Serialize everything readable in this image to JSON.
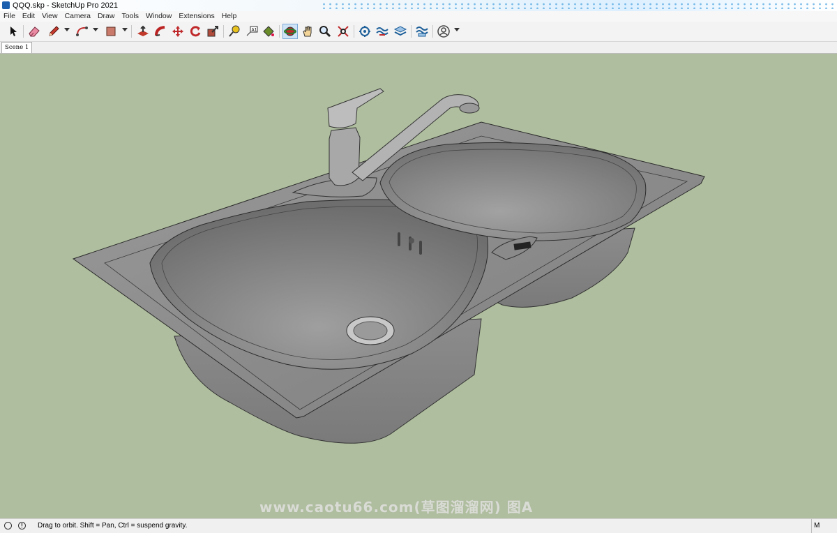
{
  "window": {
    "title": "QQQ.skp - SketchUp Pro 2021"
  },
  "menu": [
    "File",
    "Edit",
    "View",
    "Camera",
    "Draw",
    "Tools",
    "Window",
    "Extensions",
    "Help"
  ],
  "toolbar": {
    "icons": [
      "select-icon",
      "eraser-icon",
      "pencil-icon",
      "arc-icon",
      "rectangle-icon",
      "push-pull-icon",
      "follow-me-icon",
      "move-icon",
      "rotate-icon",
      "scale-icon",
      "tape-measure-icon",
      "text-icon",
      "paint-bucket-icon",
      "orbit-icon",
      "pan-icon",
      "zoom-icon",
      "zoom-extents-icon",
      "warehouse-icon",
      "extension-warehouse-icon",
      "layers-icon",
      "styles-icon",
      "account-icon"
    ],
    "active_tool": "orbit-icon"
  },
  "scenes": {
    "tabs": [
      "Scene 1"
    ]
  },
  "viewport": {
    "background": "#afbe9e",
    "watermark": "www.caotu66.com(草图溜溜网) 图A"
  },
  "status": {
    "message": "Drag to orbit. Shift = Pan, Ctrl = suspend gravity.",
    "measurements_label": "M"
  }
}
